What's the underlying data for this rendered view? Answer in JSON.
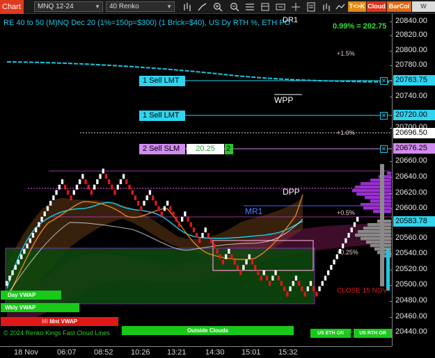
{
  "toolbar": {
    "chart_tab": "Chart",
    "instrument": "MNQ 12-24",
    "bar_type": "40 Renko",
    "btn_tk": "T<>K",
    "btn_cloud": "Cloud",
    "btn_barcol": "BarCol",
    "btn_vwap": "W VWAP"
  },
  "chart": {
    "title": "RE 40 to 50 (M)NQ Dec 20 (1%=150p=$300) (1 Brick=$40), US Dy RTH %, ETH PO",
    "dr1_label": "DR1",
    "pct_display": "0.99% = 202.75",
    "pct_labels": [
      "+1.5%",
      "+1.0%",
      "+0.5%",
      "+0.25%"
    ],
    "wpp_label": "WPP",
    "dpp_label": "DPP",
    "mr1_label": "MR1",
    "close_label": "CLOSE 15 NOV",
    "copyright": "© 2024 Renko Kings Fast Cloud Lines"
  },
  "orders": [
    {
      "label": "1 Sell LMT",
      "price": 20763.75
    },
    {
      "label": "1 Sell LMT",
      "price": 20720.0
    },
    {
      "label": "2 Sell SLM",
      "price": 20676.25,
      "offset": "20.25",
      "qty": "2"
    }
  ],
  "current_price": "20696.50",
  "axis_prices": [
    "20763.75",
    "20720.00",
    "20696.50",
    "20676.25",
    "20583.78"
  ],
  "y_axis": {
    "ticks": [
      "20840.00",
      "20820.00",
      "20800.00",
      "20780.00",
      "20760.00",
      "20740.00",
      "20700.00",
      "20660.00",
      "20640.00",
      "20620.00",
      "20600.00",
      "20560.00",
      "20540.00",
      "20520.00",
      "20500.00",
      "20480.00",
      "20460.00",
      "20440.00"
    ]
  },
  "x_axis": {
    "labels": [
      "18 Nov",
      "06:07",
      "08:52",
      "10:26",
      "13:21",
      "14:30",
      "15:01",
      "15:32"
    ]
  },
  "badges": {
    "day_vwap": "Day VWAP",
    "wkly_vwap": "Wkly VWAP",
    "mnt_vwap": "Mnt VWAP",
    "mnt_prefix": "Mi",
    "outside_clouds": "Outside Clouds",
    "us_eth_or": "US ETH OR",
    "us_rth_or": "US RTH OR",
    "pct_small": "0.25%"
  },
  "colors": {
    "cyan": "#19c9e6",
    "green_pct": "#2ee52e",
    "order_cyan": "#2fd4ef",
    "order_violet": "#d28bf0",
    "bull_brick": "#ffffff",
    "bear_brick": "#e01818",
    "purple": "#9b2fd1"
  }
}
